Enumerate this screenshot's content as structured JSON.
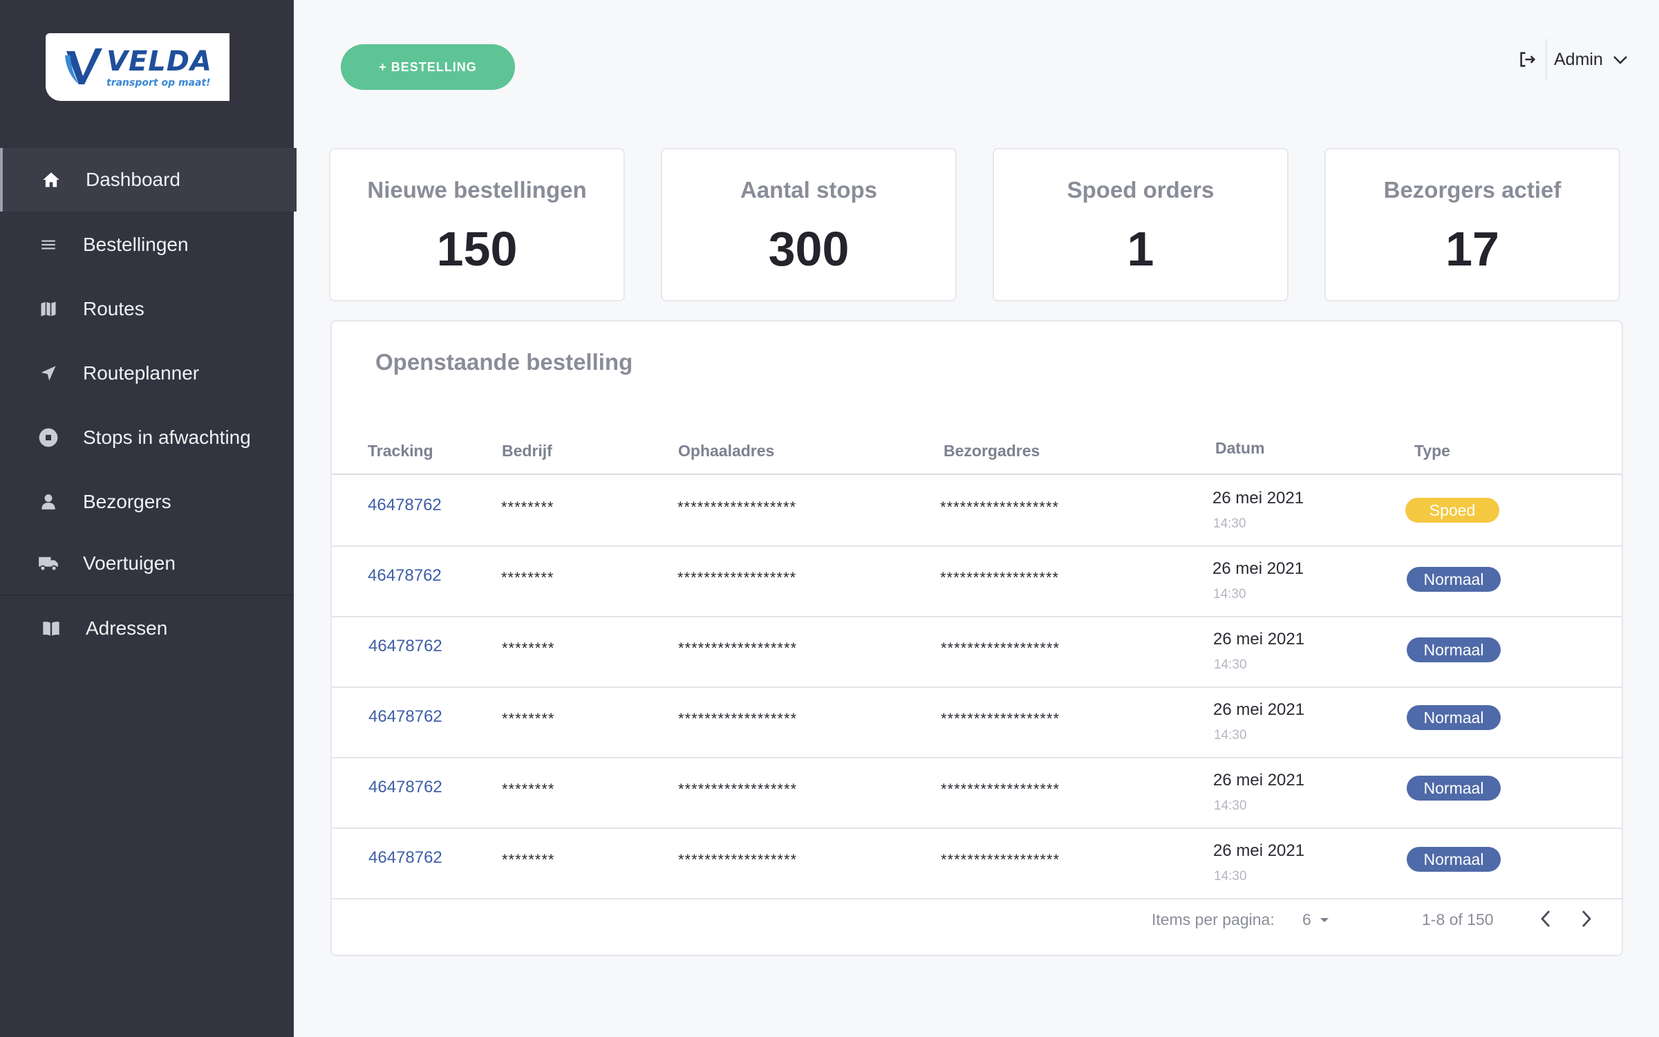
{
  "logo": {
    "name": "VELDA",
    "tagline": "transport op maat!"
  },
  "sidebar": {
    "items": [
      {
        "label": "Dashboard",
        "icon": "home-icon"
      },
      {
        "label": "Bestellingen",
        "icon": "list-icon"
      },
      {
        "label": "Routes",
        "icon": "map-icon"
      },
      {
        "label": "Routeplanner",
        "icon": "navigation-icon"
      },
      {
        "label": "Stops in afwachting",
        "icon": "stop-circle-icon"
      },
      {
        "label": "Bezorgers",
        "icon": "person-icon"
      },
      {
        "label": "Voertuigen",
        "icon": "truck-icon"
      },
      {
        "label": "Adressen",
        "icon": "book-icon"
      }
    ]
  },
  "header": {
    "add_button": "+ BESTELLING",
    "user": "Admin"
  },
  "stats": [
    {
      "label": "Nieuwe bestellingen",
      "value": "150"
    },
    {
      "label": "Aantal stops",
      "value": "300"
    },
    {
      "label": "Spoed orders",
      "value": "1"
    },
    {
      "label": "Bezorgers actief",
      "value": "17"
    }
  ],
  "table": {
    "title": "Openstaande bestelling",
    "columns": [
      "Tracking",
      "Bedrijf",
      "Ophaaladres",
      "Bezorgadres",
      "Datum",
      "Type"
    ],
    "rows": [
      {
        "tracking": "46478762",
        "company": "********",
        "pickup": "******************",
        "delivery": "******************",
        "date": "26 mei 2021",
        "time": "14:30",
        "type": "Spoed"
      },
      {
        "tracking": "46478762",
        "company": "********",
        "pickup": "******************",
        "delivery": "******************",
        "date": "26 mei 2021",
        "time": "14:30",
        "type": "Normaal"
      },
      {
        "tracking": "46478762",
        "company": "********",
        "pickup": "******************",
        "delivery": "******************",
        "date": "26 mei 2021",
        "time": "14:30",
        "type": "Normaal"
      },
      {
        "tracking": "46478762",
        "company": "********",
        "pickup": "******************",
        "delivery": "******************",
        "date": "26 mei 2021",
        "time": "14:30",
        "type": "Normaal"
      },
      {
        "tracking": "46478762",
        "company": "********",
        "pickup": "******************",
        "delivery": "******************",
        "date": "26 mei 2021",
        "time": "14:30",
        "type": "Normaal"
      },
      {
        "tracking": "46478762",
        "company": "********",
        "pickup": "******************",
        "delivery": "******************",
        "date": "26 mei 2021",
        "time": "14:30",
        "type": "Normaal"
      }
    ],
    "footer": {
      "items_per_page_label": "Items per pagina:",
      "items_per_page": "6",
      "range": "1-8 of 150"
    }
  },
  "colors": {
    "spoed": "#f5c842",
    "normaal": "#4f6aa8",
    "accent": "#5ec495",
    "sidebar": "#33343f"
  }
}
